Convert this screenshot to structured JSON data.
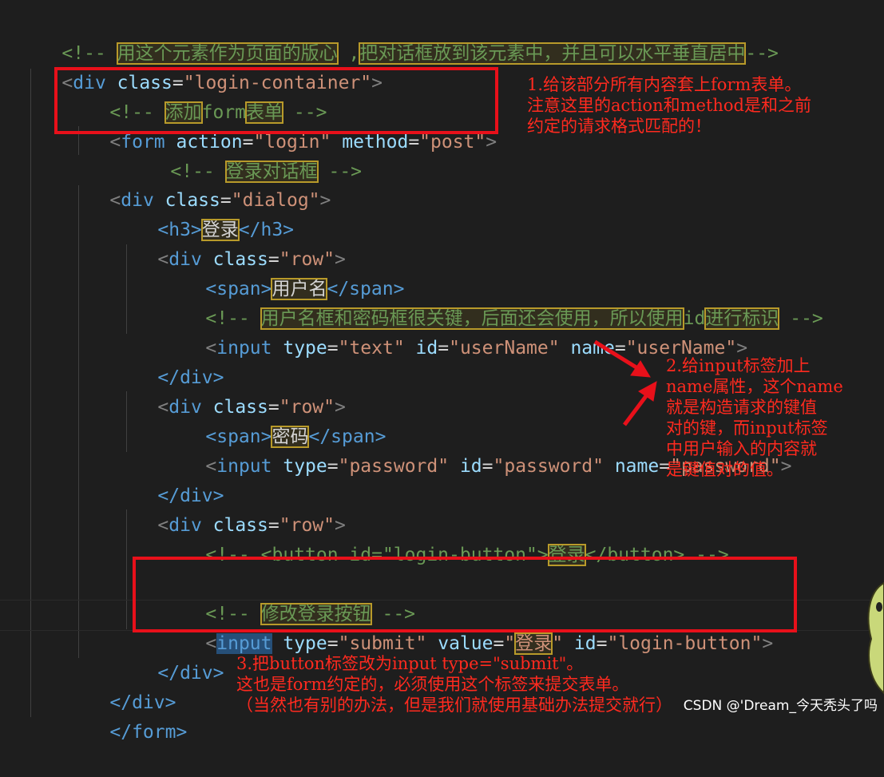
{
  "code_lines": {
    "l1_comment_open": "<!-- ",
    "l1_text_a": "用这个元素作为页面的版心",
    "l1_text_mid": " ,",
    "l1_text_b": "把对话框放到该元素中，并且可以水平垂直居中",
    "l1_comment_close": "-->",
    "l2_open": "<",
    "l2_tag": "div",
    "l2_attr": " class",
    "l2_eq": "=",
    "l2_val": "\"login-container\"",
    "l2_close": ">",
    "l3_comment_open": "<!-- ",
    "l3_text_a": "添加",
    "l3_text_mid": "form",
    "l3_text_b": "表单",
    "l3_comment_close": " -->",
    "l4_open": "<",
    "l4_tag": "form",
    "l4_attr1": " action",
    "l4_eq1": "=",
    "l4_val1": "\"login\"",
    "l4_attr2": " method",
    "l4_eq2": "=",
    "l4_val2": "\"post\"",
    "l4_close": ">",
    "l5_comment_open": "<!-- ",
    "l5_text": "登录对话框",
    "l5_comment_close": " -->",
    "l6_open": "<",
    "l6_tag": "div",
    "l6_attr": " class",
    "l6_eq": "=",
    "l6_val": "\"dialog\"",
    "l6_close": ">",
    "l7_open": "<h3>",
    "l7_text": "登录",
    "l7_close": "</h3>",
    "l8_open": "<",
    "l8_tag": "div",
    "l8_attr": " class",
    "l8_eq": "=",
    "l8_val": "\"row\"",
    "l8_close": ">",
    "l9_open": "<span>",
    "l9_text": "用户名",
    "l9_close": "</span>",
    "l10_comment_open": "<!-- ",
    "l10_text_a": "用户名框和密码框很关键，后面还会使用，所以使用",
    "l10_text_mid": "id",
    "l10_text_b": "进行标识",
    "l10_comment_close": " -->",
    "l11_open": "<",
    "l11_tag": "input",
    "l11_attr1": " type",
    "l11_eq1": "=",
    "l11_val1": "\"text\"",
    "l11_attr2": " id",
    "l11_eq2": "=",
    "l11_val2": "\"userName\"",
    "l11_attr3": " name",
    "l11_eq3": "=",
    "l11_val3": "\"userName\"",
    "l11_close": ">",
    "l12_text": "</div>",
    "l13_open": "<",
    "l13_tag": "div",
    "l13_attr": " class",
    "l13_eq": "=",
    "l13_val": "\"row\"",
    "l13_close": ">",
    "l14_open": "<span>",
    "l14_text": "密码",
    "l14_close": "</span>",
    "l15_open": "<",
    "l15_tag": "input",
    "l15_attr1": " type",
    "l15_eq1": "=",
    "l15_val1": "\"password\"",
    "l15_attr2": " id",
    "l15_eq2": "=",
    "l15_val2": "\"password\"",
    "l15_attr3": " name",
    "l15_eq3": "=",
    "l15_val3": "\"password\"",
    "l15_close": ">",
    "l16_text": "</div>",
    "l17_open": "<",
    "l17_tag": "div",
    "l17_attr": " class",
    "l17_eq": "=",
    "l17_val": "\"row\"",
    "l17_close": ">",
    "l18_comment_a": "<!-- <button id=\"login-button\">",
    "l18_text": "登录",
    "l18_comment_b": "</button> -->",
    "l20_comment_open": "<!-- ",
    "l20_text": "修改登录按钮",
    "l20_comment_close": " -->",
    "l21_open": "<",
    "l21_tag": "input",
    "l21_attr1": " type",
    "l21_eq1": "=",
    "l21_val1": "\"submit\"",
    "l21_attr2": " value",
    "l21_eq2": "=",
    "l21_val2a": "\"",
    "l21_val2text": "登录",
    "l21_val2b": "\"",
    "l21_attr3": " id",
    "l21_eq3": "=",
    "l21_val3": "\"login-button\"",
    "l21_close": ">",
    "l22_text": "</div>",
    "l23_text": "</div>",
    "l24_text": "</form>"
  },
  "annotations": {
    "note1": "1.给该部分所有内容套上form表单。\n注意这里的action和method是和之前\n约定的请求格式匹配的！",
    "note2": "2.给input标签加上\nname属性，这个name\n就是构造请求的键值\n对的键，而input标签\n中用户输入的内容就\n是键值对的值。",
    "note3": "3.把button标签改为input type=\"submit\"。\n这也是form约定的，必须使用这个标签来提交表单。\n（当然也有别的办法，但是我们就使用基础办法提交就行）"
  },
  "watermark": "CSDN @'Dream_今天秃头了吗",
  "colors": {
    "background": "#1e1e1e",
    "tag": "#569cd6",
    "attribute": "#9cdcfe",
    "string": "#ce9178",
    "comment": "#6a9955",
    "annotation_red": "#e8101a"
  }
}
